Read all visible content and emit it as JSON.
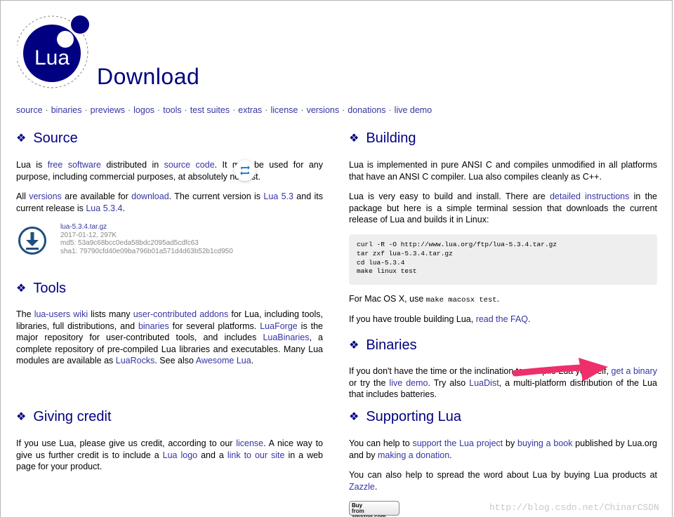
{
  "page": {
    "title": "Download"
  },
  "logo": {
    "text": "Lua"
  },
  "nav": [
    "source",
    "binaries",
    "previews",
    "logos",
    "tools",
    "test suites",
    "extras",
    "license",
    "versions",
    "donations",
    "live demo"
  ],
  "source": {
    "heading": "Source",
    "p1": [
      "Lua is ",
      "free software",
      " distributed in ",
      "source code",
      ". It may be used for any purpose, including commercial purposes, at absolutely no cost."
    ],
    "p2": [
      "All ",
      "versions",
      " are available for ",
      "download",
      ". The current version is ",
      "Lua 5.3",
      " and its current release is ",
      "Lua 5.3.4",
      "."
    ],
    "download": {
      "filename": "lua-5.3.4.tar.gz",
      "date_size": "2017-01-12, 297K",
      "md5": "md5: 53a9c68bcc0eda58bdc2095ad5cdfc63",
      "sha1": "sha1: 79790cfd40e09ba796b01a571d4d63b52b1cd950"
    }
  },
  "tools": {
    "heading": "Tools",
    "p": [
      "The ",
      "lua-users wiki",
      " lists many ",
      "user-contributed addons",
      " for Lua, including tools, libraries, full distributions, and ",
      "binaries",
      " for several platforms. ",
      "LuaForge",
      " is the major repository for user-contributed tools, and includes ",
      "LuaBinaries",
      ", a complete repository of pre-compiled Lua libraries and executables. Many Lua modules are available as ",
      "LuaRocks",
      ". See also ",
      "Awesome Lua",
      "."
    ]
  },
  "credit": {
    "heading": "Giving credit",
    "p": [
      "If you use Lua, please give us credit, according to our ",
      "license",
      ". A nice way to give us further credit is to include a ",
      "Lua logo",
      " and a ",
      "link to our site",
      " in a web page for your product."
    ]
  },
  "building": {
    "heading": "Building",
    "p1": "Lua is implemented in pure ANSI C and compiles unmodified in all platforms that have an ANSI C compiler. Lua also compiles cleanly as C++.",
    "p2": [
      "Lua is very easy to build and install. There are ",
      "detailed instructions",
      " in the package but here is a simple terminal session that downloads the current release of Lua and builds it in Linux:"
    ],
    "code": "curl -R -O http://www.lua.org/ftp/lua-5.3.4.tar.gz\ntar zxf lua-5.3.4.tar.gz\ncd lua-5.3.4\nmake linux test",
    "mac_pre": "For Mac OS X, use ",
    "mac_code": "make macosx test",
    "mac_post": ".",
    "faq": [
      "If you have trouble building Lua, ",
      "read the FAQ",
      "."
    ]
  },
  "binaries": {
    "heading": "Binaries",
    "p": [
      "If you don't have the time or the inclination to compile Lua yourself, ",
      "get a binary",
      " or try the ",
      "live demo",
      ". Try also ",
      "LuaDist",
      ", a multi-platform distribution of the Lua that includes batteries."
    ]
  },
  "supporting": {
    "heading": "Supporting Lua",
    "p1": [
      "You can help to ",
      "support the Lua project",
      " by ",
      "buying a book",
      " published by Lua.org and by ",
      "making a donation",
      "."
    ],
    "p2": [
      "You can also help to spread the word about Lua by buying Lua products at ",
      "Zazzle",
      "."
    ],
    "amazon": {
      "line1": "Buy",
      "line2": "from amazon.com"
    }
  },
  "watermark": "http://blog.csdn.net/ChinarCSDN",
  "colors": {
    "heading": "#000080",
    "link": "#3535a4",
    "arrow": "#ee2f6b",
    "logo_blue": "#000080"
  },
  "icons": [
    "lua-logo",
    "download-icon",
    "retweet-icon",
    "arrow-annotation",
    "diamond-bullet-icon"
  ]
}
